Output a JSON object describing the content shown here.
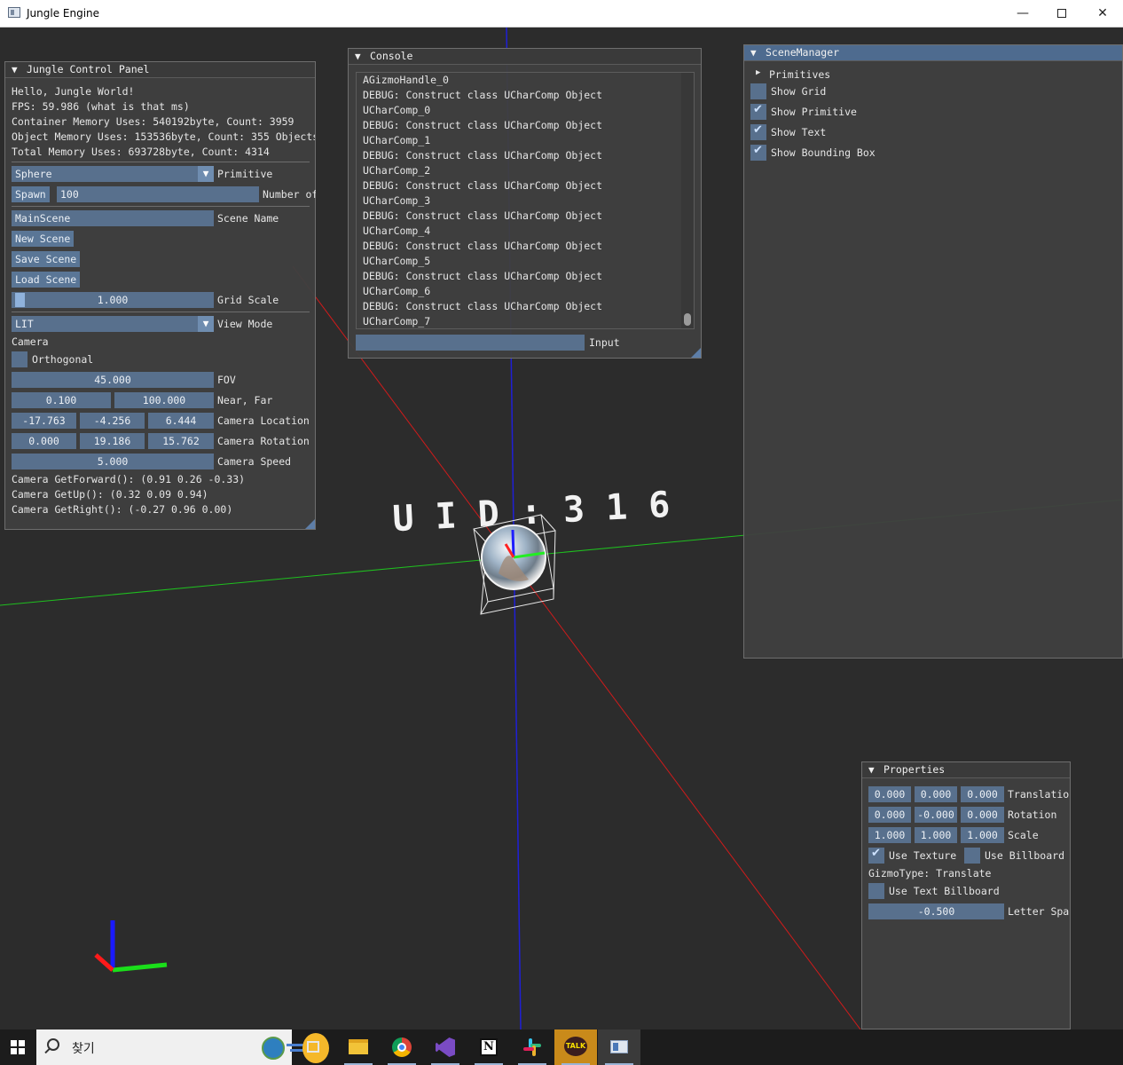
{
  "window": {
    "title": "Jungle Engine",
    "minimize_icon": "minimize-icon",
    "maximize_icon": "maximize-icon",
    "close_icon": "close-icon"
  },
  "control_panel": {
    "title": "Jungle Control Panel",
    "hello": "Hello, Jungle World!",
    "fps": "FPS: 59.986 (what is that ms)",
    "container_mem": "Container Memory Uses: 540192byte, Count: 3959",
    "object_mem": "Object Memory Uses: 153536byte, Count: 355 Objects",
    "total_mem": "Total Memory Uses: 693728byte, Count: 4314",
    "primitive_value": "Sphere",
    "primitive_label": "Primitive",
    "spawn_button": "Spawn",
    "spawn_count": "100",
    "spawn_count_label": "Number of",
    "scene_name_value": "MainScene",
    "scene_name_label": "Scene Name",
    "new_scene": "New Scene",
    "save_scene": "Save Scene",
    "load_scene": "Load Scene",
    "grid_scale_value": "1.000",
    "grid_scale_label": "Grid Scale",
    "view_mode_value": "LIT",
    "view_mode_label": "View Mode",
    "camera_heading": "Camera",
    "orthogonal_label": "Orthogonal",
    "orthogonal_checked": false,
    "fov_value": "45.000",
    "fov_label": "FOV",
    "near_value": "0.100",
    "far_value": "100.000",
    "near_far_label": "Near, Far",
    "cam_loc": [
      "-17.763",
      "-4.256",
      "6.444"
    ],
    "cam_loc_label": "Camera Location",
    "cam_rot": [
      "0.000",
      "19.186",
      "15.762"
    ],
    "cam_rot_label": "Camera Rotation",
    "cam_speed_value": "5.000",
    "cam_speed_label": "Camera Speed",
    "forward": "Camera GetForward(): (0.91 0.26 -0.33)",
    "up": "Camera GetUp(): (0.32 0.09 0.94)",
    "right": "Camera GetRight(): (-0.27 0.96 0.00)"
  },
  "console": {
    "title": "Console",
    "lines": [
      "AGizmoHandle_0",
      "DEBUG: Construct class UCharComp Object",
      "UCharComp_0",
      "DEBUG: Construct class UCharComp Object",
      "UCharComp_1",
      "DEBUG: Construct class UCharComp Object",
      "UCharComp_2",
      "DEBUG: Construct class UCharComp Object",
      "UCharComp_3",
      "DEBUG: Construct class UCharComp Object",
      "UCharComp_4",
      "DEBUG: Construct class UCharComp Object",
      "UCharComp_5",
      "DEBUG: Construct class UCharComp Object",
      "UCharComp_6",
      "DEBUG: Construct class UCharComp Object",
      "UCharComp_7"
    ],
    "input_value": "",
    "input_label": "Input"
  },
  "scene_manager": {
    "title": "SceneManager",
    "primitives_node": "Primitives",
    "options": [
      {
        "label": "Show Grid",
        "checked": false
      },
      {
        "label": "Show Primitive",
        "checked": true
      },
      {
        "label": "Show Text",
        "checked": true
      },
      {
        "label": "Show Bounding Box",
        "checked": true
      }
    ]
  },
  "properties": {
    "title": "Properties",
    "translation": [
      "0.000",
      "0.000",
      "0.000"
    ],
    "translation_label": "Translation",
    "rotation": [
      "0.000",
      "-0.000",
      "0.000"
    ],
    "rotation_label": "Rotation",
    "scale": [
      "1.000",
      "1.000",
      "1.000"
    ],
    "scale_label": "Scale",
    "use_texture_label": "Use Texture",
    "use_texture_checked": true,
    "use_billboard_label": "Use Billboard",
    "use_billboard_checked": false,
    "gizmo_type": "GizmoType: Translate",
    "use_text_billboard_label": "Use Text Billboard",
    "use_text_billboard_checked": false,
    "letter_spacing_value": "-0.500",
    "letter_spacing_label": "Letter Spacing"
  },
  "scene": {
    "billboard_text": "U I D :  3 1 6",
    "axis_colors": {
      "x": "#ff0000",
      "y": "#00ff00",
      "z": "#0000ff"
    }
  },
  "taskbar": {
    "search_label": "찾기",
    "apps": [
      "start-icon",
      "search-icon",
      "news-widget-icon",
      "task-view-icon",
      "file-explorer-icon",
      "chrome-icon",
      "visual-studio-icon",
      "notion-icon",
      "slack-icon",
      "kakaotalk-icon",
      "jungle-engine-icon"
    ],
    "kakao_label": "TALK",
    "notion_label": "N"
  }
}
